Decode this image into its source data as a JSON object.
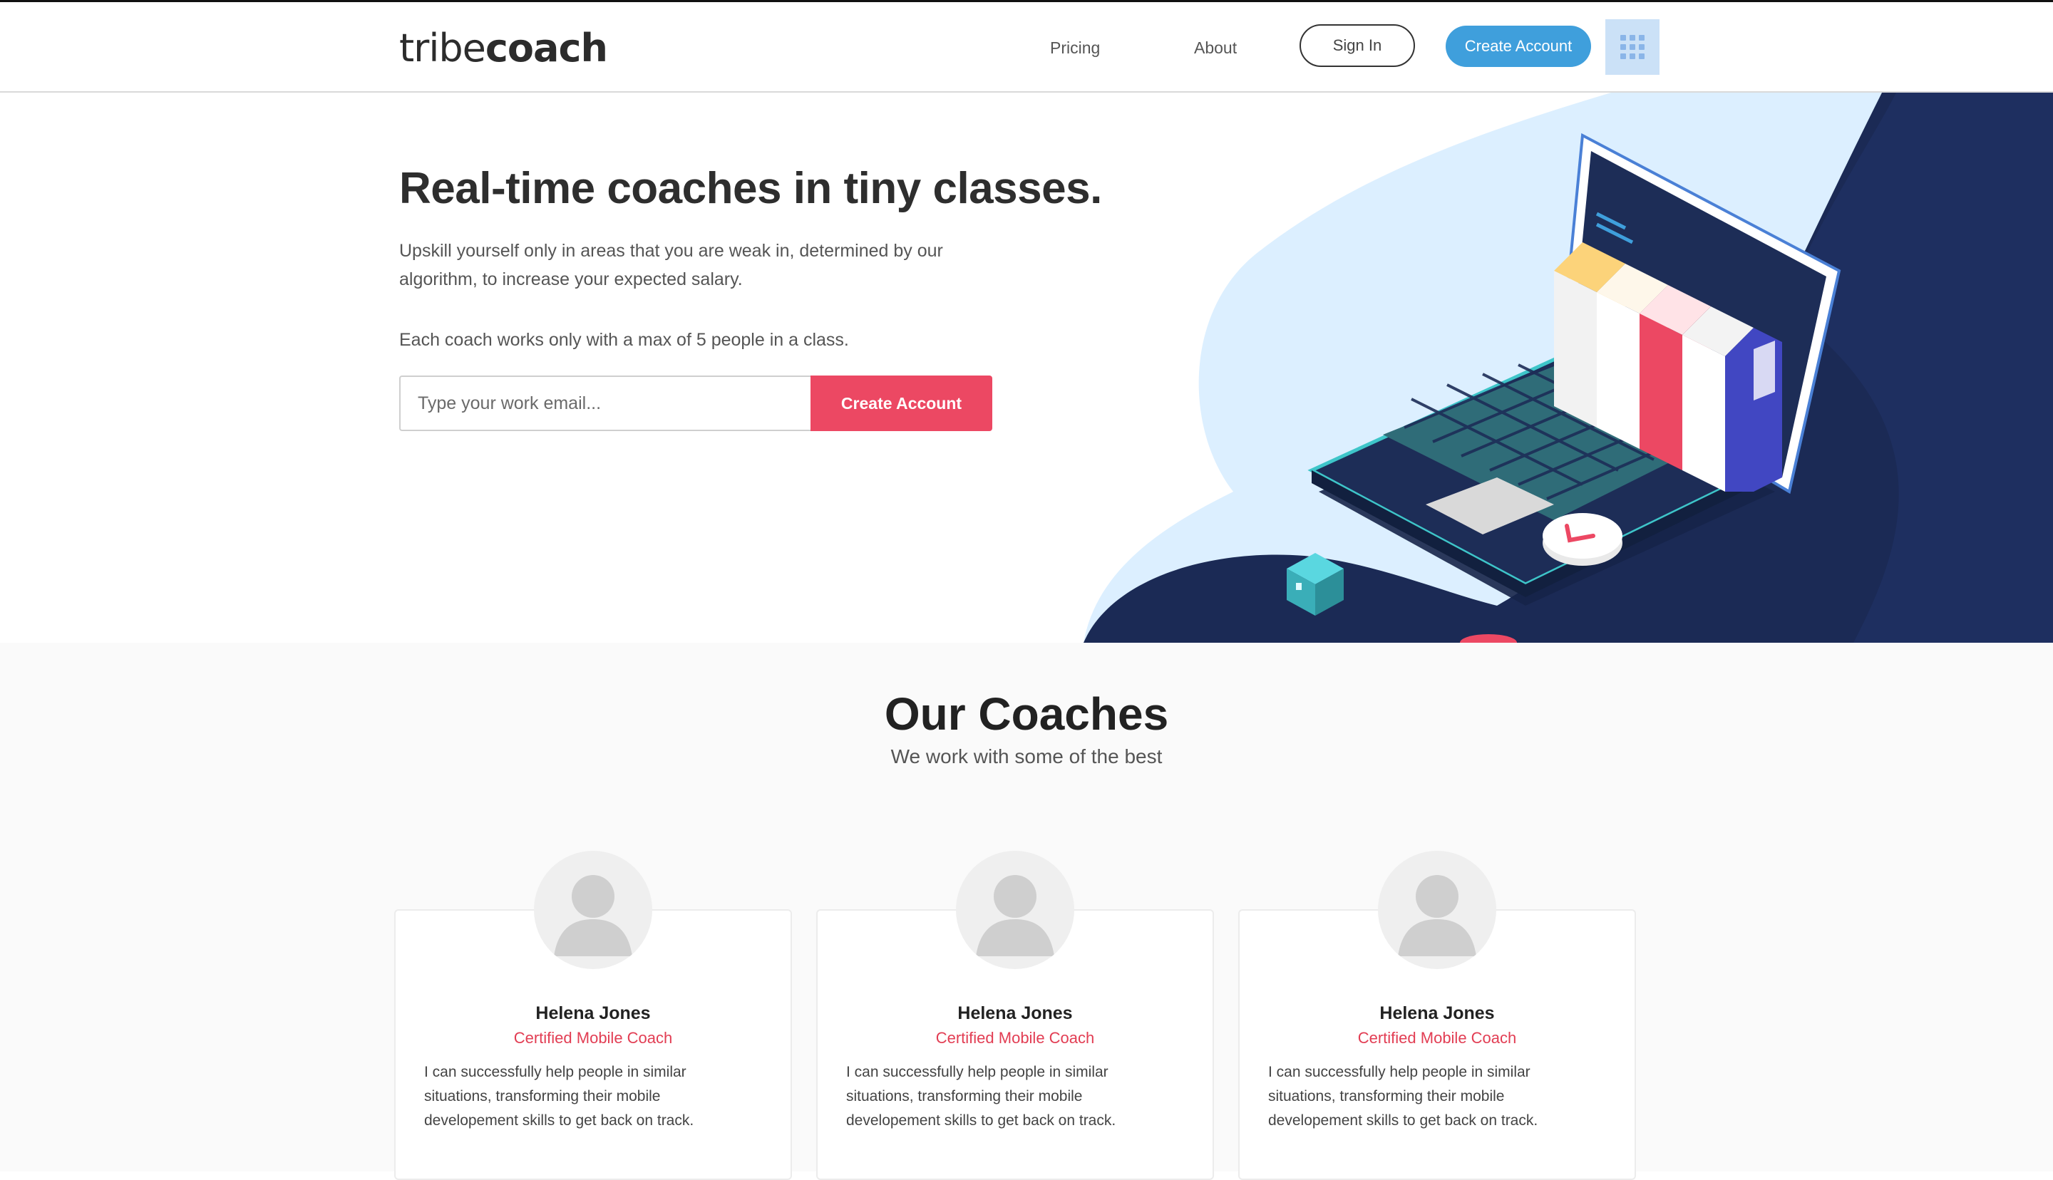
{
  "header": {
    "logo_light": "tribe",
    "logo_bold": "coach",
    "nav": {
      "pricing": "Pricing",
      "about": "About"
    },
    "sign_in": "Sign In",
    "create_account": "Create Account",
    "apps_icon": "grid-icon"
  },
  "hero": {
    "title": "Real-time coaches in tiny classes.",
    "description": "Upskill yourself only in areas that you are weak in, determined by our algorithm, to increase your expected salary.",
    "note": "Each coach works only with a max of 5 people in a class.",
    "email_placeholder": "Type your work email...",
    "email_value": "",
    "cta": "Create Account"
  },
  "coaches": {
    "title": "Our Coaches",
    "subtitle": "We work with some of the best",
    "items": [
      {
        "name": "Helena Jones",
        "role": "Certified Mobile Coach",
        "bio": "I can successfully help people in similar situations, transforming their mobile developement skills to get back on track."
      },
      {
        "name": "Helena Jones",
        "role": "Certified Mobile Coach",
        "bio": "I can successfully help people in similar situations, transforming their mobile developement skills to get back on track."
      },
      {
        "name": "Helena Jones",
        "role": "Certified Mobile Coach",
        "bio": "I can successfully help people in similar situations, transforming their mobile developement skills to get back on track."
      }
    ]
  },
  "colors": {
    "primary_blue": "#3f9fdc",
    "accent_red": "#ec4863",
    "navy": "#1b2a55",
    "light_blue": "#dcefff"
  }
}
